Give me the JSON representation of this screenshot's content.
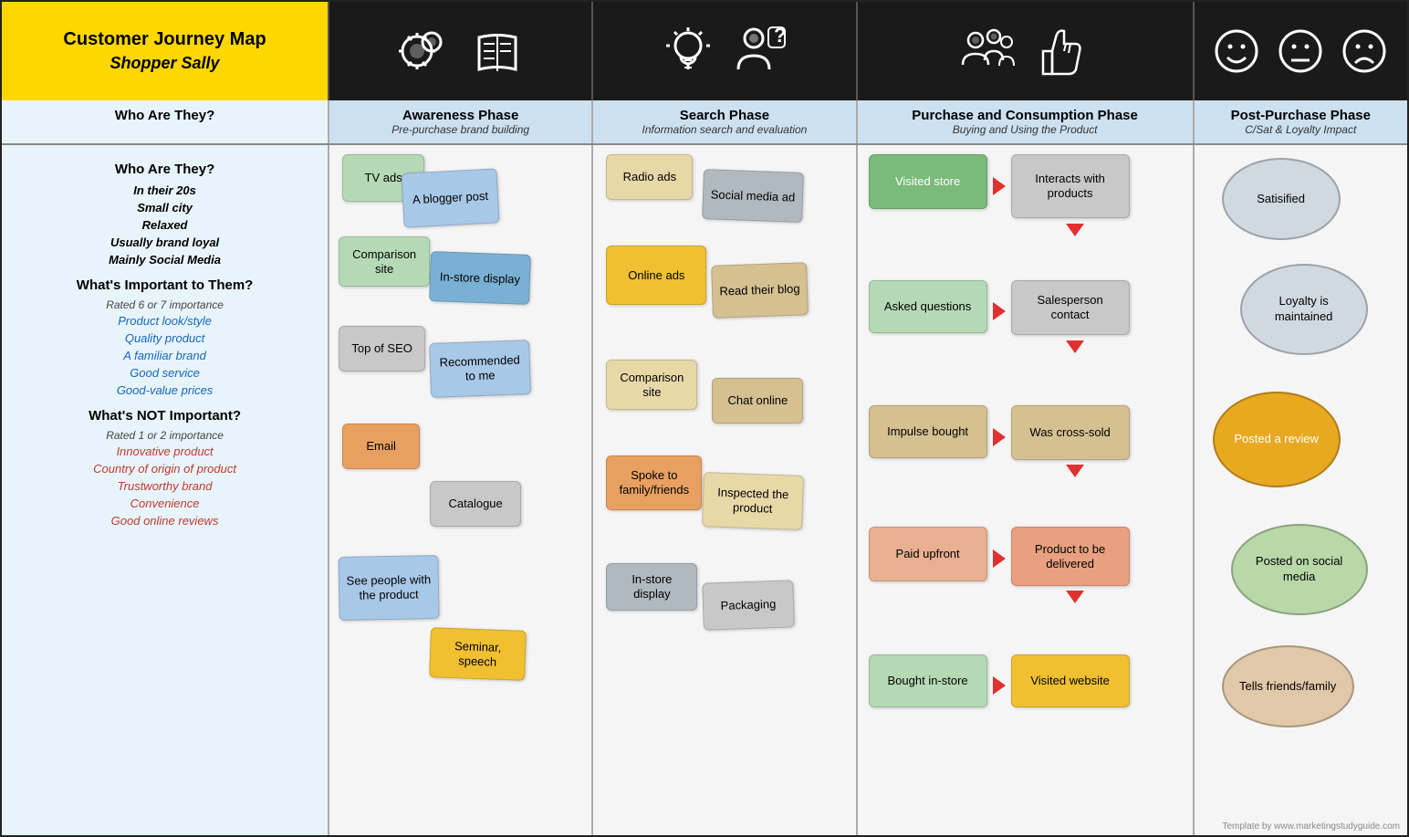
{
  "header": {
    "title": "Customer Journey Map",
    "subtitle": "Shopper Sally"
  },
  "phases": [
    {
      "key": "awareness",
      "title": "Awareness Phase",
      "subtitle": "Pre-purchase brand building"
    },
    {
      "key": "search",
      "title": "Search Phase",
      "subtitle": "Information search and evaluation"
    },
    {
      "key": "purchase",
      "title": "Purchase and Consumption Phase",
      "subtitle": "Buying and Using the Product"
    },
    {
      "key": "postpurchase",
      "title": "Post-Purchase Phase",
      "subtitle": "C/Sat & Loyalty Impact"
    }
  ],
  "left_panel": {
    "who_title": "Who Are They?",
    "who_items": [
      "In their 20s",
      "Small city",
      "Relaxed",
      "Usually brand loyal",
      "Mainly Social Media"
    ],
    "important_title": "What's Important to Them?",
    "important_sub": "Rated 6 or 7 importance",
    "important_items": [
      "Product look/style",
      "Quality product",
      "A familiar brand",
      "Good service",
      "Good-value prices"
    ],
    "not_important_title": "What's NOT Important?",
    "not_important_sub": "Rated 1 or 2 importance",
    "not_important_items": [
      "Innovative product",
      "Country of origin of product",
      "Trustworthy brand",
      "Convenience",
      "Good online reviews"
    ]
  },
  "watermark": "Template by www.marketingstudyguide.com"
}
